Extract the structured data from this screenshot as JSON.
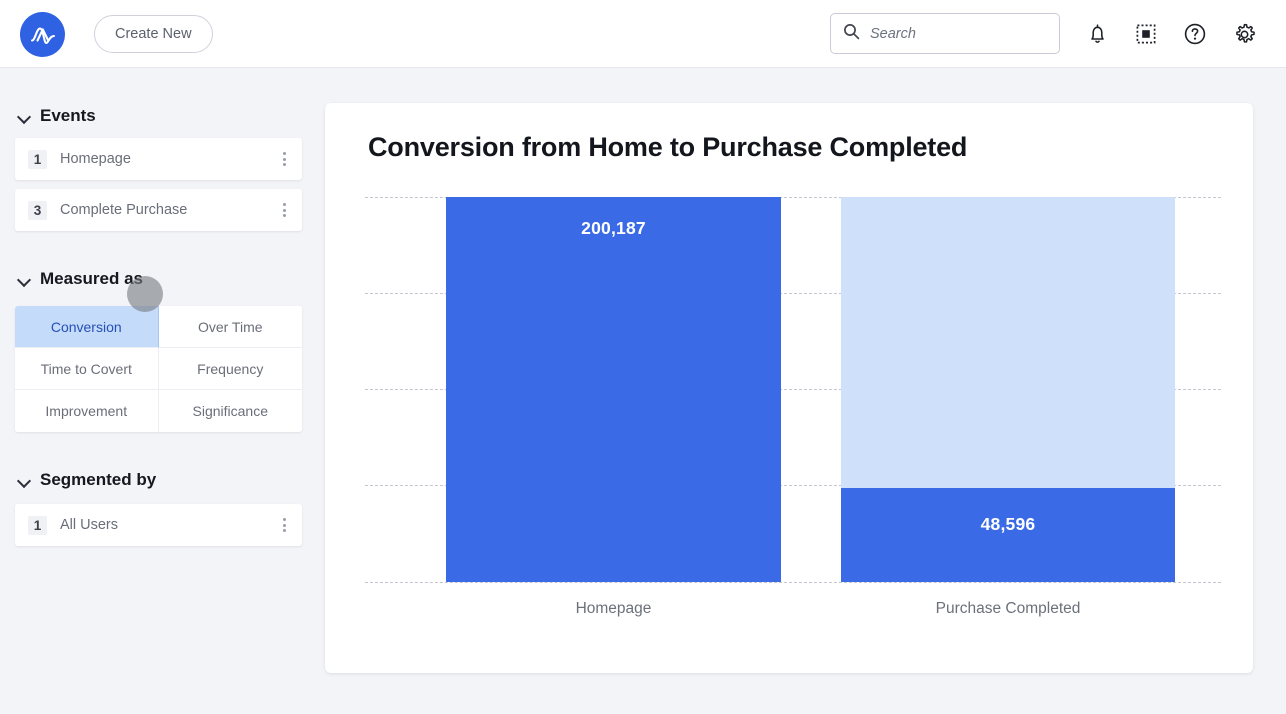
{
  "topbar": {
    "logo_name": "amplitude-logo",
    "create_new_label": "Create New",
    "search": {
      "placeholder": "Search",
      "value": ""
    },
    "icons": [
      {
        "name": "bell-icon",
        "label": "Notifications"
      },
      {
        "name": "grid-icon",
        "label": "Apps"
      },
      {
        "name": "help-icon",
        "label": "Help"
      },
      {
        "name": "gear-icon",
        "label": "Settings"
      }
    ]
  },
  "sidebar": {
    "events": {
      "title": "Events",
      "items": [
        {
          "num": "1",
          "label": "Homepage"
        },
        {
          "num": "3",
          "label": "Complete Purchase"
        }
      ]
    },
    "measured_as": {
      "title": "Measured as",
      "options": [
        {
          "label": "Conversion",
          "selected": true
        },
        {
          "label": "Over Time",
          "selected": false
        },
        {
          "label": "Time to Covert",
          "selected": false
        },
        {
          "label": "Frequency",
          "selected": false
        },
        {
          "label": "Improvement",
          "selected": false
        },
        {
          "label": "Significance",
          "selected": false
        }
      ]
    },
    "segmented_by": {
      "title": "Segmented by",
      "items": [
        {
          "num": "1",
          "label": "All Users"
        }
      ]
    }
  },
  "main": {
    "card_title": "Conversion from Home to Purchase Completed"
  },
  "chart_data": {
    "type": "bar",
    "title": "Conversion from Home to Purchase Completed",
    "xlabel": "",
    "ylabel": "",
    "categories": [
      "Homepage",
      "Purchase Completed"
    ],
    "values": [
      200187,
      48596
    ],
    "value_labels": [
      "200,187",
      "48,596"
    ],
    "totals": [
      200187,
      200187
    ],
    "ylim": [
      0,
      200187
    ],
    "grid": true,
    "gridline_count": 5,
    "legend": "none",
    "colors": {
      "value_fill": "#3a6ae6",
      "remainder_fill": "#cfe0fa",
      "gridline": "#c3c6cf",
      "value_label": "#ffffff"
    }
  },
  "colors": {
    "accent": "#3a6ae6",
    "accent_light": "#cfe0fa",
    "page_bg": "#f3f4f8",
    "card_bg": "#ffffff",
    "selected_tab_bg": "#c5dbfa",
    "selected_tab_text": "#2550b8"
  }
}
